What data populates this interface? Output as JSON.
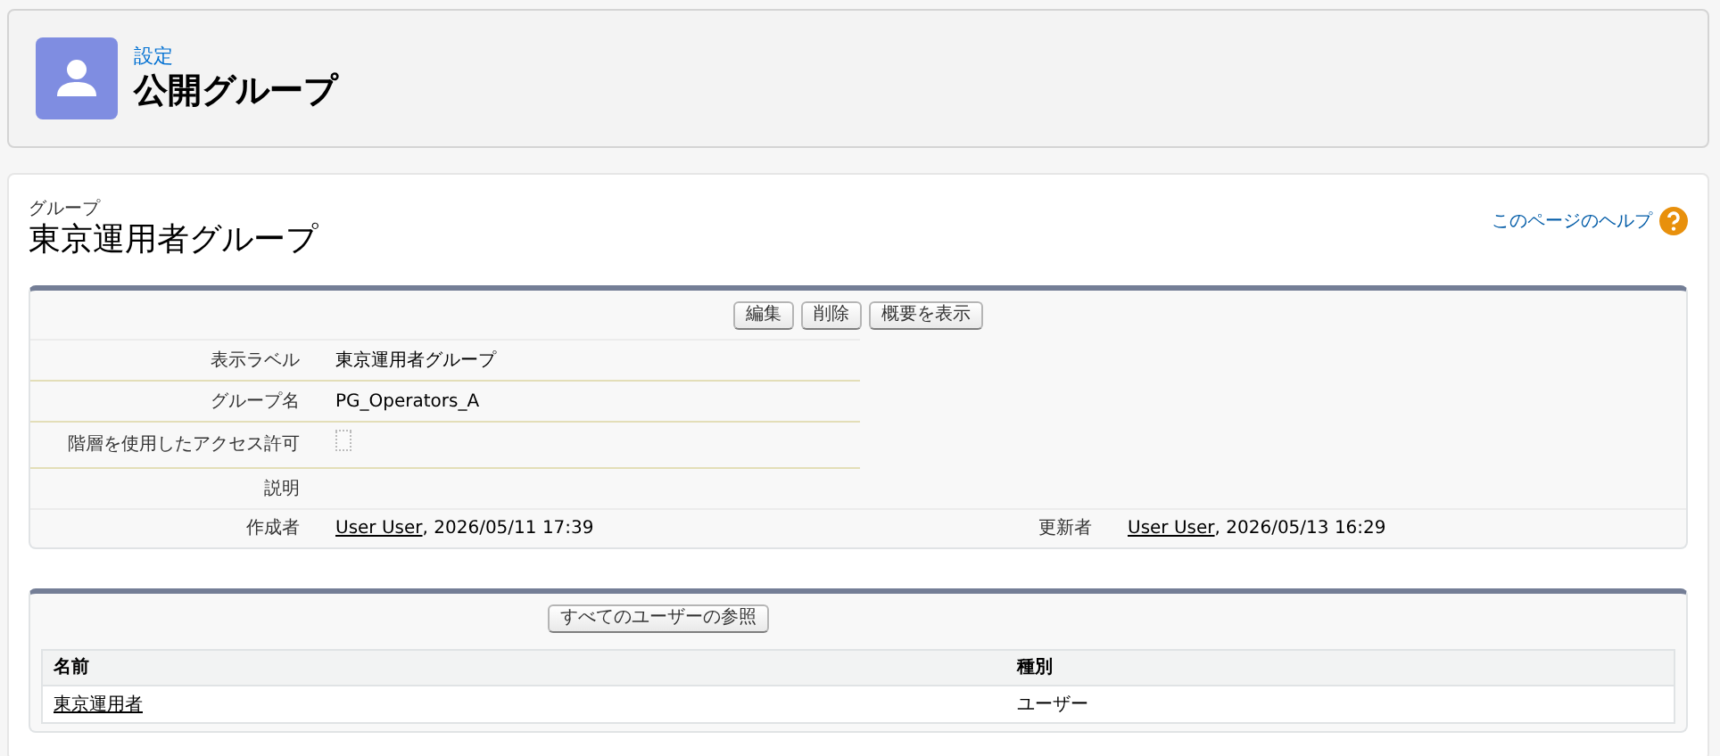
{
  "header": {
    "breadcrumb": "設定",
    "title": "公開グループ"
  },
  "record": {
    "type_label": "グループ",
    "name": "東京運用者グループ",
    "help_link": "このページのヘルプ"
  },
  "detail": {
    "buttons": [
      "編集",
      "削除",
      "概要を表示"
    ],
    "fields": [
      {
        "kind": "text",
        "label": "表示ラベル",
        "value": "東京運用者グループ"
      },
      {
        "kind": "text",
        "label": "グループ名",
        "value": "PG_Operators_A"
      },
      {
        "kind": "checkbox",
        "label": "階層を使用したアクセス許可",
        "checked": false
      },
      {
        "kind": "text",
        "label": "説明"
      }
    ],
    "created": {
      "label": "作成者",
      "user": "User User",
      "date": ", 2026/05/11 17:39"
    },
    "modified": {
      "label": "更新者",
      "user": "User User",
      "date": ", 2026/05/13 16:29"
    }
  },
  "members": {
    "button": "すべてのユーザーの参照",
    "columns": [
      "名前",
      "種別"
    ],
    "rows": [
      {
        "name": "東京運用者",
        "type": "ユーザー"
      }
    ]
  }
}
